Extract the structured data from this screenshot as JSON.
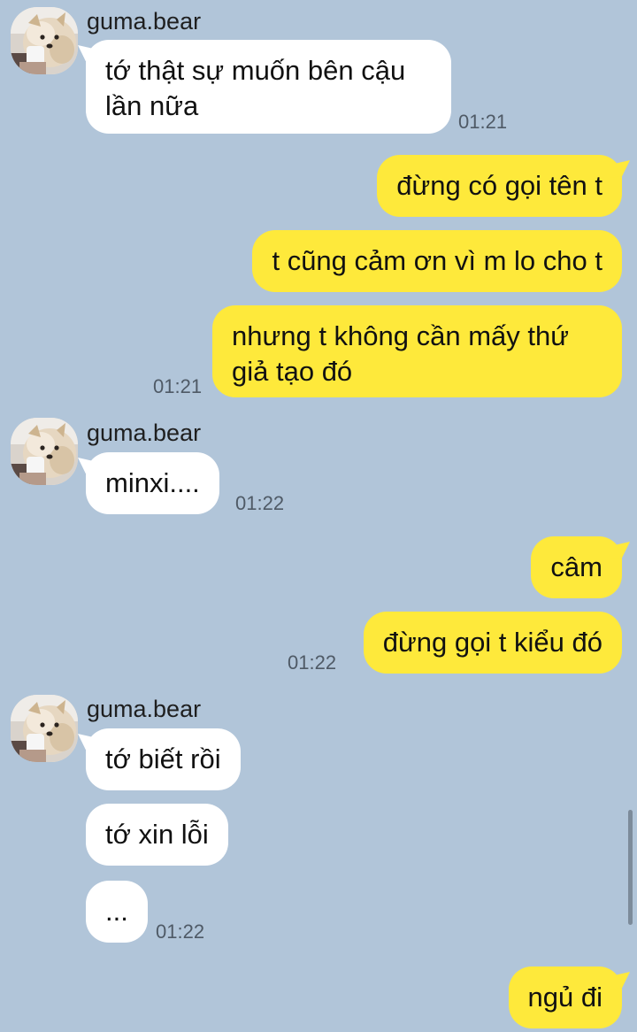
{
  "contact": {
    "name": "guma.bear",
    "avatar_icon": "pomeranian-dog-photo"
  },
  "colors": {
    "background": "#b1c5d9",
    "incoming_bubble": "#ffffff",
    "outgoing_bubble": "#fee93b",
    "timestamp": "#4f5a66"
  },
  "groups": [
    {
      "sender": "guma.bear",
      "messages": [
        {
          "line1": "tớ thật sự muốn bên cậu",
          "line2": "lần nữa"
        }
      ],
      "time": "01:21"
    },
    {
      "sender": "me",
      "messages": [
        {
          "text": "đừng có gọi tên t"
        },
        {
          "text": "t cũng cảm ơn vì m lo cho t"
        },
        {
          "line1": "nhưng t không cần mấy thứ",
          "line2": "giả tạo đó"
        }
      ],
      "time": "01:21"
    },
    {
      "sender": "guma.bear",
      "messages": [
        {
          "text": "minxi...."
        }
      ],
      "time": "01:22"
    },
    {
      "sender": "me",
      "messages": [
        {
          "text": "câm"
        },
        {
          "text": "đừng gọi t kiểu đó"
        }
      ],
      "time": "01:22"
    },
    {
      "sender": "guma.bear",
      "messages": [
        {
          "text": "tớ biết rồi"
        },
        {
          "text": "tớ xin lỗi"
        },
        {
          "text": "..."
        }
      ],
      "time": "01:22"
    },
    {
      "sender": "me",
      "messages": [
        {
          "text": "ngủ đi"
        }
      ]
    }
  ]
}
